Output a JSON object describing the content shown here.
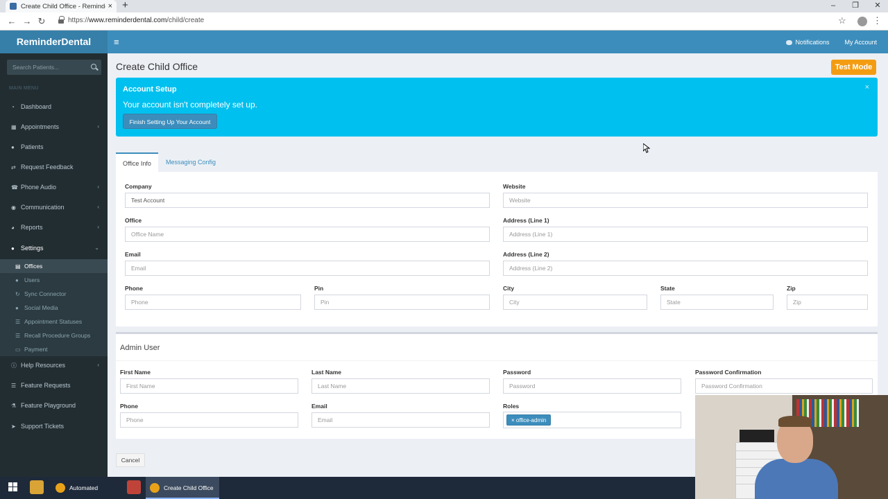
{
  "browser": {
    "tab_title": "Create Child Office - ReminderDe",
    "tab_close": "×",
    "new_tab": "+",
    "url_scheme": "https://",
    "url_host": "www.reminderdental.com",
    "url_path": "/child/create",
    "window_controls": [
      "–",
      "❐",
      "✕"
    ]
  },
  "header": {
    "brand": "ReminderDental",
    "notifications": "Notifications",
    "my_account": "My Account"
  },
  "sidebar": {
    "search_placeholder": "Search Patients...",
    "menu_header": "MAIN MENU",
    "items": [
      {
        "label": "Dashboard",
        "icon": "dashboard-icon",
        "has_chevron": false
      },
      {
        "label": "Appointments",
        "icon": "calendar-icon",
        "has_chevron": true
      },
      {
        "label": "Patients",
        "icon": "users-icon",
        "has_chevron": false
      },
      {
        "label": "Request Feedback",
        "icon": "retweet-icon",
        "has_chevron": false
      },
      {
        "label": "Phone Audio",
        "icon": "phone-icon",
        "has_chevron": true
      },
      {
        "label": "Communication",
        "icon": "comments-icon",
        "has_chevron": true
      },
      {
        "label": "Reports",
        "icon": "pie-chart-icon",
        "has_chevron": true
      },
      {
        "label": "Settings",
        "icon": "user-icon",
        "has_chevron": true
      }
    ],
    "settings_sub": [
      {
        "label": "Offices",
        "icon": "building-icon",
        "active": true
      },
      {
        "label": "Users",
        "icon": "user-icon"
      },
      {
        "label": "Sync Connector",
        "icon": "refresh-icon"
      },
      {
        "label": "Social Media",
        "icon": "users-icon"
      },
      {
        "label": "Appointment Statuses",
        "icon": "list-icon"
      },
      {
        "label": "Recall Procedure Groups",
        "icon": "list-icon"
      },
      {
        "label": "Payment",
        "icon": "money-icon"
      }
    ],
    "bottom_items": [
      {
        "label": "Help Resources",
        "icon": "info-icon",
        "has_chevron": true
      },
      {
        "label": "Feature Requests",
        "icon": "list-icon",
        "has_chevron": false
      },
      {
        "label": "Feature Playground",
        "icon": "flask-icon",
        "has_chevron": false
      },
      {
        "label": "Support Tickets",
        "icon": "paper-plane-icon",
        "has_chevron": false
      }
    ]
  },
  "main": {
    "title": "Create Child Office",
    "test_mode": "Test Mode",
    "callout": {
      "heading": "Account Setup",
      "message": "Your account isn't completely set up.",
      "button": "Finish Setting Up Your Account",
      "close": "×"
    },
    "tabs": [
      "Office Info",
      "Messaging Config"
    ],
    "office": {
      "company_label": "Company",
      "company_value": "Test Account",
      "website_label": "Website",
      "website_placeholder": "Website",
      "office_label": "Office",
      "office_placeholder": "Office Name",
      "addr1_label": "Address (Line 1)",
      "addr1_placeholder": "Address (Line 1)",
      "email_label": "Email",
      "email_placeholder": "Email",
      "addr2_label": "Address (Line 2)",
      "addr2_placeholder": "Address (Line 2)",
      "phone_label": "Phone",
      "phone_placeholder": "Phone",
      "pin_label": "Pin",
      "pin_placeholder": "Pin",
      "city_label": "City",
      "city_placeholder": "City",
      "state_label": "State",
      "state_placeholder": "State",
      "zip_label": "Zip",
      "zip_placeholder": "Zip"
    },
    "admin": {
      "title": "Admin User",
      "first_label": "First Name",
      "first_placeholder": "First Name",
      "last_label": "Last Name",
      "last_placeholder": "Last Name",
      "password_label": "Password",
      "password_placeholder": "Password",
      "confirm_label": "Password Confirmation",
      "confirm_placeholder": "Password Confirmation",
      "phone_label": "Phone",
      "phone_placeholder": "Phone",
      "email_label": "Email",
      "email_placeholder": "Email",
      "roles_label": "Roles",
      "role_tag": "office-admin",
      "role_remove": "×"
    },
    "cancel": "Cancel"
  },
  "taskbar": {
    "items": [
      "Automated Messag...",
      "Create Child Office ..."
    ]
  },
  "colors": {
    "primary": "#3c8dbc",
    "callout": "#00c0ef",
    "test_mode": "#f39c12",
    "sidebar": "#222d32"
  }
}
